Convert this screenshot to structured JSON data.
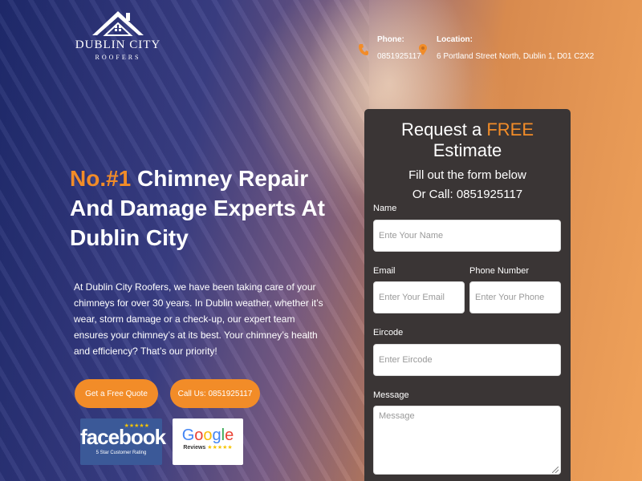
{
  "brand": {
    "name": "DUBLIN CITY",
    "tagline": "ROOFERS"
  },
  "contact": {
    "phone_label": "Phone:",
    "phone_value": "0851925117",
    "location_label": "Location:",
    "location_value": "6 Portland Street North, Dublin 1, D01 C2X2"
  },
  "hero": {
    "headline_accent": "No.#1",
    "headline_rest": " Chimney Repair And Damage Experts At Dublin City",
    "description": "At Dublin City Roofers, we have been taking care of your chimneys for over 30 years. In Dublin weather, whether it’s wear, storm damage or a check-up, our expert team ensures your chimney’s at its best. Your chimney’s health and efficiency? That’s our priority!",
    "quote_button": "Get a Free Quote",
    "call_button": "Call Us: 0851925117"
  },
  "badges": {
    "facebook_name": "facebook",
    "facebook_stars": "★★★★★",
    "facebook_sub": "5 Star Customer Rating",
    "google_letters": [
      "G",
      "o",
      "o",
      "g",
      "l",
      "e"
    ],
    "google_sub": "Reviews",
    "google_stars": "★★★★★"
  },
  "form": {
    "title_pre": "Request a ",
    "title_free": "FREE",
    "title_post": " Estimate",
    "subtitle_line1": "Fill out the form below",
    "subtitle_line2": "Or Call: 0851925117",
    "name_label": "Name",
    "name_placeholder": "Ente Your Name",
    "email_label": "Email",
    "email_placeholder": "Enter Your Email",
    "phone_label": "Phone Number",
    "phone_placeholder": "Enter Your Phone",
    "eircode_label": "Eircode",
    "eircode_placeholder": "Enter Eircode",
    "message_label": "Message",
    "message_placeholder": "Message"
  },
  "icons": {
    "phone": "phone-icon",
    "location": "location-pin-icon"
  },
  "colors": {
    "accent": "#f28c28",
    "form_bg": "#3a3535",
    "facebook": "#3b5998",
    "google_blue": "#4285f4",
    "google_red": "#ea4335",
    "google_yellow": "#fbbc05",
    "google_green": "#34a853"
  }
}
